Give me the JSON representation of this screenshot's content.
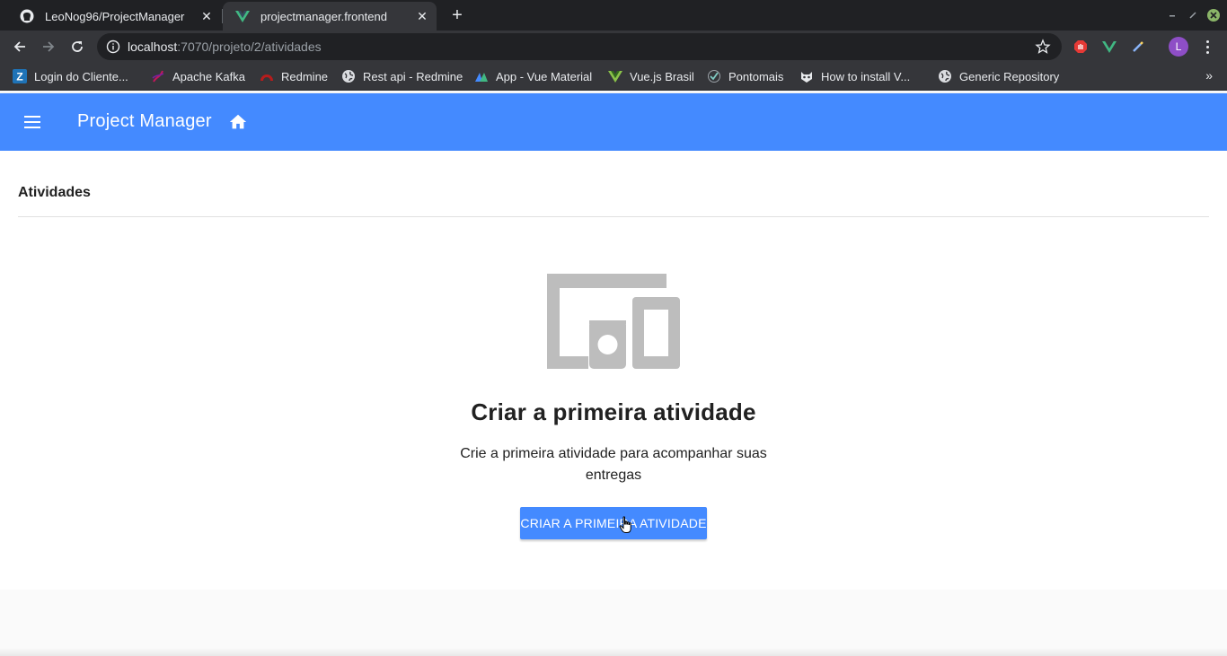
{
  "browser": {
    "tabs": [
      {
        "title": "LeoNog96/ProjectManager",
        "icon": "github-icon",
        "active": false
      },
      {
        "title": "projectmanager.frontend",
        "icon": "vue-icon",
        "active": true
      }
    ],
    "address": {
      "host": "localhost",
      "path": ":7070/projeto/2/atividades"
    },
    "profile_initial": "L",
    "bookmarks": [
      {
        "label": "Login do Cliente...",
        "icon": "zendesk-icon"
      },
      {
        "label": "Apache Kafka",
        "icon": "kafka-icon"
      },
      {
        "label": "Redmine",
        "icon": "redmine-icon"
      },
      {
        "label": "Rest api - Redmine",
        "icon": "globe-icon"
      },
      {
        "label": "App - Vue Material",
        "icon": "vue-material-icon"
      },
      {
        "label": "Vue.js Brasil",
        "icon": "vue-icon"
      },
      {
        "label": "Pontomais",
        "icon": "check-icon"
      },
      {
        "label": "How to install V...",
        "icon": "robot-icon"
      },
      {
        "label": "Generic Repository",
        "icon": "globe-icon"
      }
    ],
    "bookmarks_more": "»"
  },
  "app": {
    "title": "Project Manager",
    "primary_color": "#448aff"
  },
  "content": {
    "section_title": "Atividades",
    "empty_state": {
      "icon": "devices-icon",
      "title": "Criar a primeira atividade",
      "description": "Crie a primeira atividade para acompanhar suas entregas",
      "button_label": "Criar a primeira atividade"
    }
  }
}
